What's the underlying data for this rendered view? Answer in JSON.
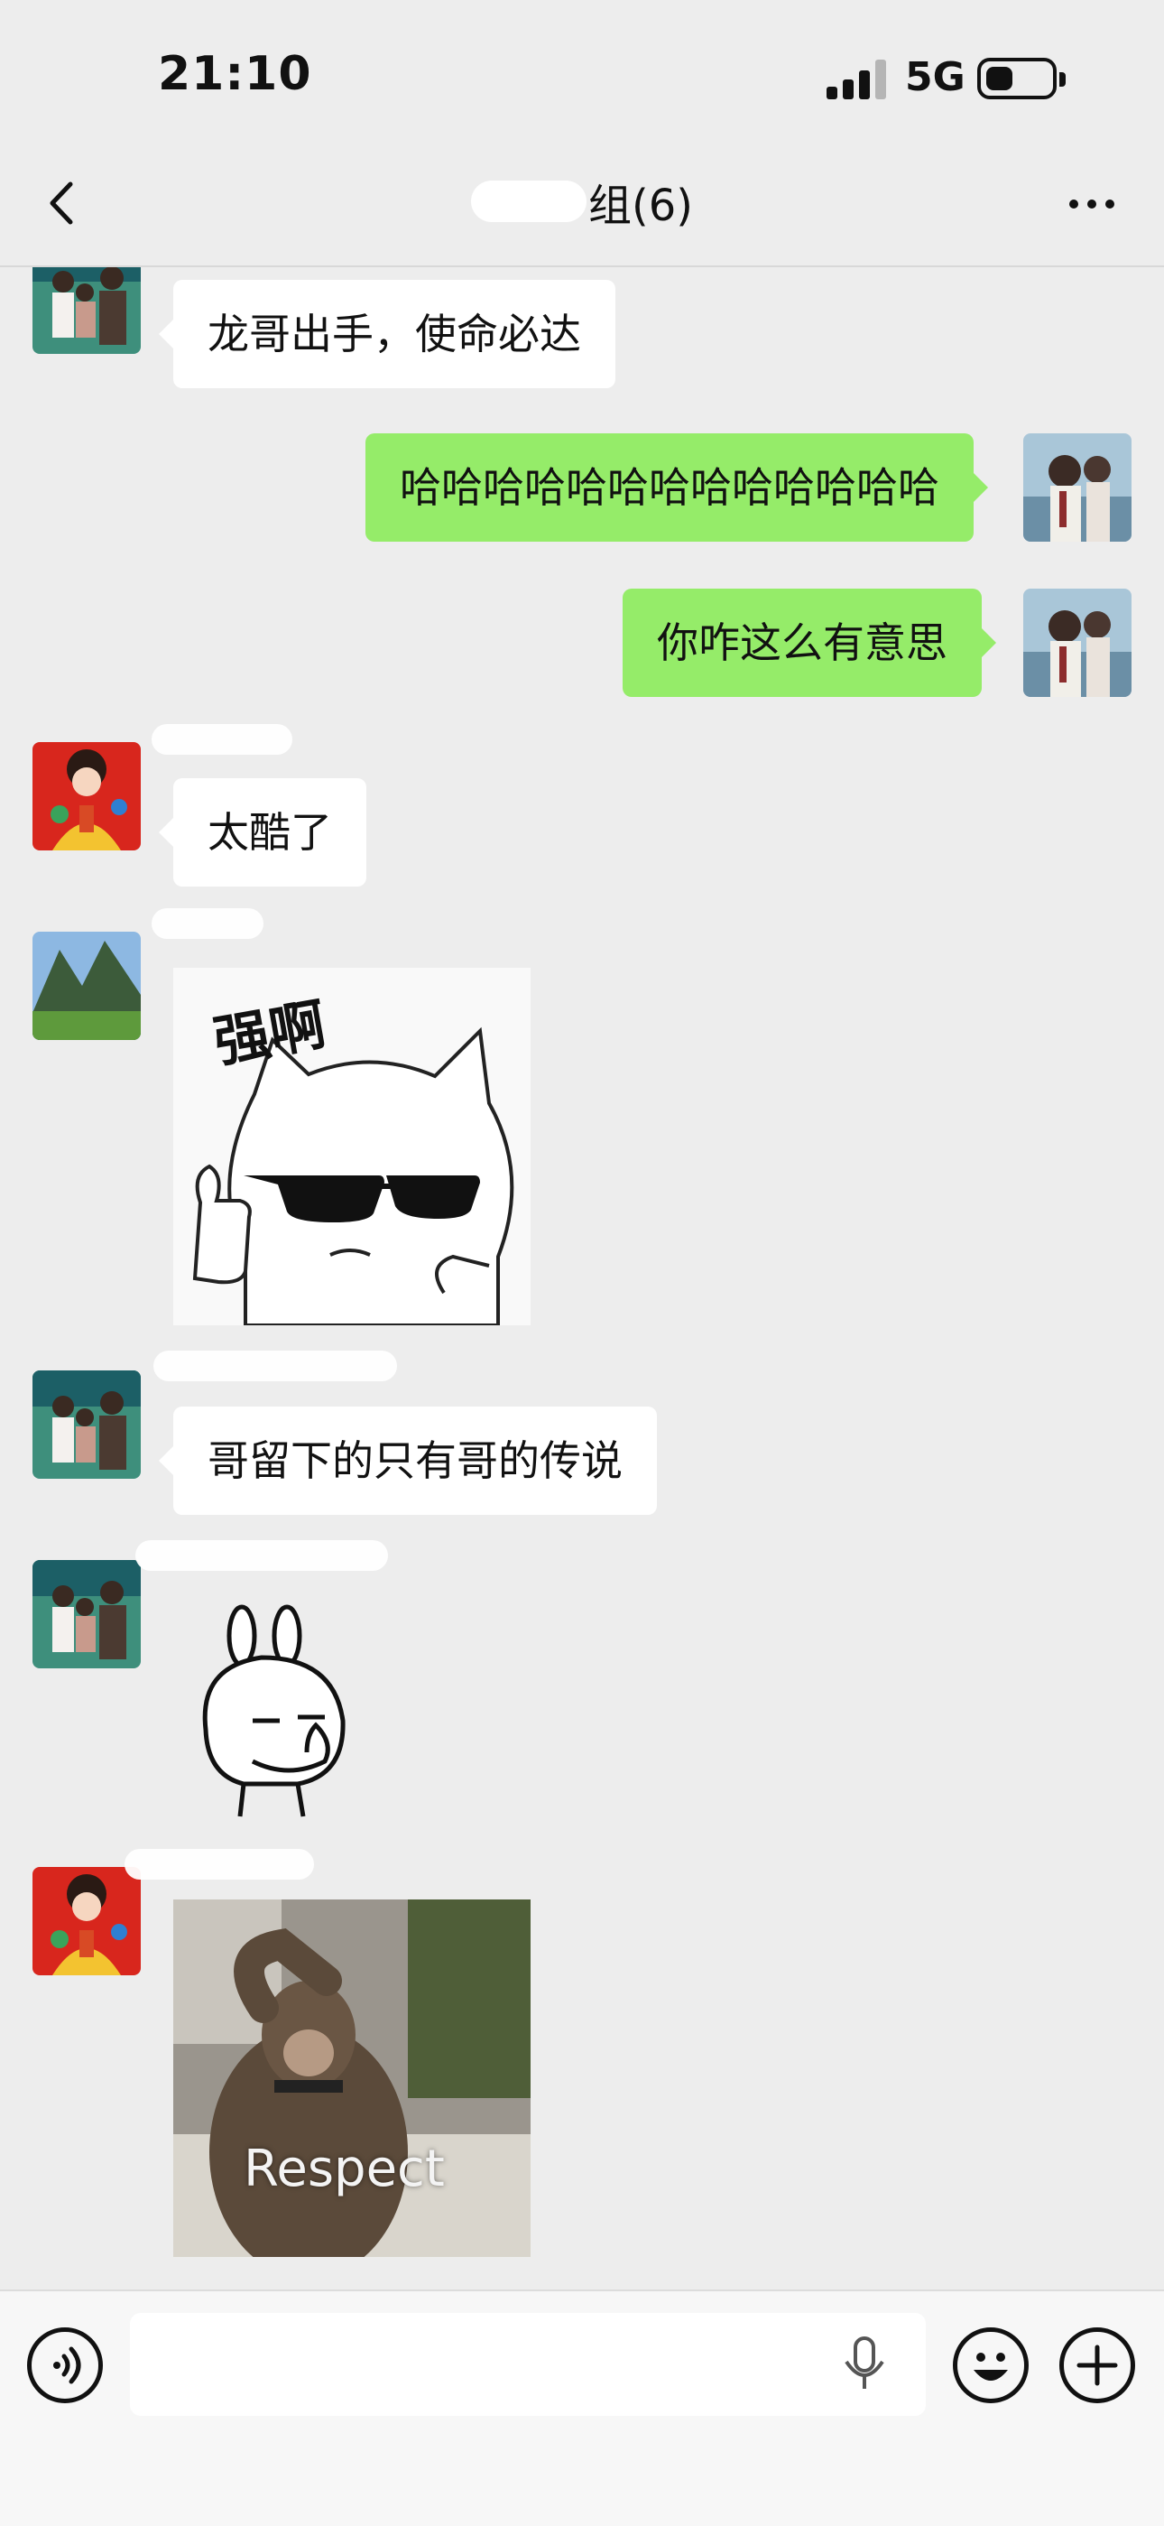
{
  "status_bar": {
    "time": "21:10",
    "network": "5G",
    "battery_level": 0.4
  },
  "nav": {
    "title": "组(6)"
  },
  "messages": [
    {
      "side": "in",
      "avatar": "family-photo-avatar",
      "text": "龙哥出手，使命必达"
    },
    {
      "side": "out",
      "avatar": "self-avatar",
      "text": "哈哈哈哈哈哈哈哈哈哈哈哈哈"
    },
    {
      "side": "out",
      "avatar": "self-avatar",
      "text": "你咋这么有意思"
    },
    {
      "side": "in",
      "avatar": "fortune-god-avatar",
      "text": "太酷了"
    },
    {
      "side": "in",
      "avatar": "landscape-avatar",
      "sticker": "cool-cat-sticker",
      "sticker_text": "强啊"
    },
    {
      "side": "in",
      "avatar": "family-photo-avatar",
      "text": "哥留下的只有哥的传说"
    },
    {
      "side": "in",
      "avatar": "family-photo-avatar",
      "sticker": "thinking-rabbit-sticker"
    },
    {
      "side": "in",
      "avatar": "fortune-god-avatar",
      "sticker": "saluting-monkey-sticker",
      "sticker_text": "Respect"
    }
  ],
  "input": {
    "placeholder": ""
  },
  "colors": {
    "background": "#ededed",
    "outgoing_bubble": "#95ec69",
    "incoming_bubble": "#ffffff"
  }
}
